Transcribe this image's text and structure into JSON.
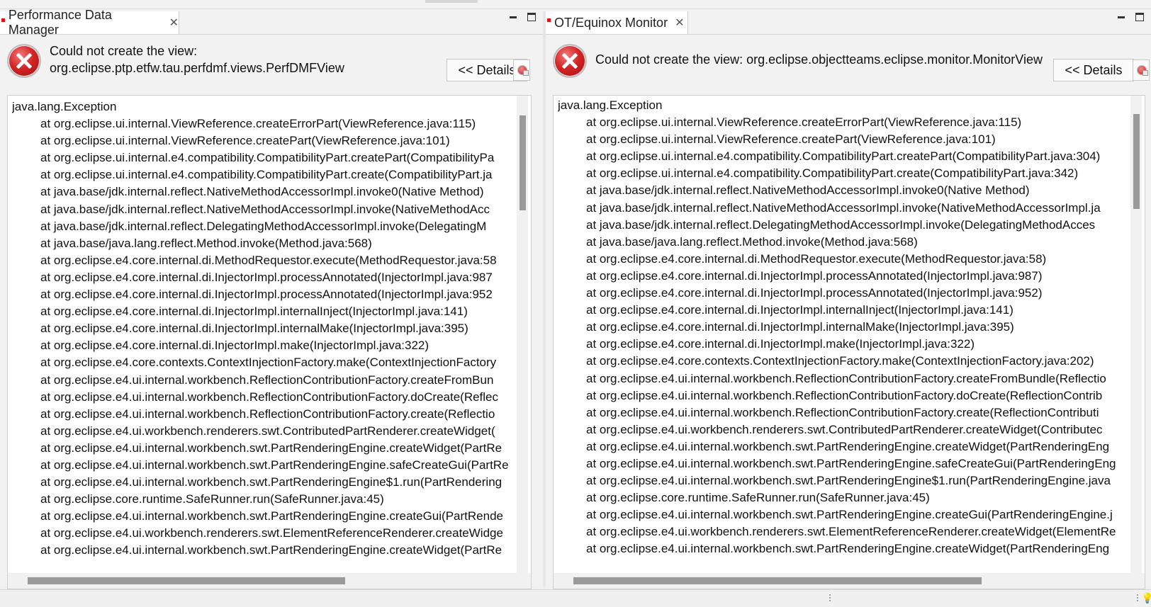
{
  "left_view": {
    "tab_title": "Performance Data Manager",
    "message_line1": "Could not create the view:",
    "message_line2": "org.eclipse.ptp.etfw.tau.perfdmf.views.PerfDMFView",
    "details_label": "<< Details",
    "trace": [
      "java.lang.Exception",
      "at org.eclipse.ui.internal.ViewReference.createErrorPart(ViewReference.java:115)",
      "at org.eclipse.ui.internal.ViewReference.createPart(ViewReference.java:101)",
      "at org.eclipse.ui.internal.e4.compatibility.CompatibilityPart.createPart(CompatibilityPa",
      "at org.eclipse.ui.internal.e4.compatibility.CompatibilityPart.create(CompatibilityPart.ja",
      "at java.base/jdk.internal.reflect.NativeMethodAccessorImpl.invoke0(Native Method)",
      "at java.base/jdk.internal.reflect.NativeMethodAccessorImpl.invoke(NativeMethodAcc",
      "at java.base/jdk.internal.reflect.DelegatingMethodAccessorImpl.invoke(DelegatingM",
      "at java.base/java.lang.reflect.Method.invoke(Method.java:568)",
      "at org.eclipse.e4.core.internal.di.MethodRequestor.execute(MethodRequestor.java:58",
      "at org.eclipse.e4.core.internal.di.InjectorImpl.processAnnotated(InjectorImpl.java:987",
      "at org.eclipse.e4.core.internal.di.InjectorImpl.processAnnotated(InjectorImpl.java:952",
      "at org.eclipse.e4.core.internal.di.InjectorImpl.internalInject(InjectorImpl.java:141)",
      "at org.eclipse.e4.core.internal.di.InjectorImpl.internalMake(InjectorImpl.java:395)",
      "at org.eclipse.e4.core.internal.di.InjectorImpl.make(InjectorImpl.java:322)",
      "at org.eclipse.e4.core.contexts.ContextInjectionFactory.make(ContextInjectionFactory",
      "at org.eclipse.e4.ui.internal.workbench.ReflectionContributionFactory.createFromBun",
      "at org.eclipse.e4.ui.internal.workbench.ReflectionContributionFactory.doCreate(Reflec",
      "at org.eclipse.e4.ui.internal.workbench.ReflectionContributionFactory.create(Reflectio",
      "at org.eclipse.e4.ui.workbench.renderers.swt.ContributedPartRenderer.createWidget(",
      "at org.eclipse.e4.ui.internal.workbench.swt.PartRenderingEngine.createWidget(PartRe",
      "at org.eclipse.e4.ui.internal.workbench.swt.PartRenderingEngine.safeCreateGui(PartRe",
      "at org.eclipse.e4.ui.internal.workbench.swt.PartRenderingEngine$1.run(PartRendering",
      "at org.eclipse.core.runtime.SafeRunner.run(SafeRunner.java:45)",
      "at org.eclipse.e4.ui.internal.workbench.swt.PartRenderingEngine.createGui(PartRende",
      "at org.eclipse.e4.ui.workbench.renderers.swt.ElementReferenceRenderer.createWidge",
      "at org.eclipse.e4.ui.internal.workbench.swt.PartRenderingEngine.createWidget(PartRe"
    ]
  },
  "right_view": {
    "tab_title": "OT/Equinox Monitor",
    "message": "Could not create the view: org.eclipse.objectteams.eclipse.monitor.MonitorView",
    "details_label": "<< Details",
    "trace": [
      "java.lang.Exception",
      "at org.eclipse.ui.internal.ViewReference.createErrorPart(ViewReference.java:115)",
      "at org.eclipse.ui.internal.ViewReference.createPart(ViewReference.java:101)",
      "at org.eclipse.ui.internal.e4.compatibility.CompatibilityPart.createPart(CompatibilityPart.java:304)",
      "at org.eclipse.ui.internal.e4.compatibility.CompatibilityPart.create(CompatibilityPart.java:342)",
      "at java.base/jdk.internal.reflect.NativeMethodAccessorImpl.invoke0(Native Method)",
      "at java.base/jdk.internal.reflect.NativeMethodAccessorImpl.invoke(NativeMethodAccessorImpl.ja",
      "at java.base/jdk.internal.reflect.DelegatingMethodAccessorImpl.invoke(DelegatingMethodAcces",
      "at java.base/java.lang.reflect.Method.invoke(Method.java:568)",
      "at org.eclipse.e4.core.internal.di.MethodRequestor.execute(MethodRequestor.java:58)",
      "at org.eclipse.e4.core.internal.di.InjectorImpl.processAnnotated(InjectorImpl.java:987)",
      "at org.eclipse.e4.core.internal.di.InjectorImpl.processAnnotated(InjectorImpl.java:952)",
      "at org.eclipse.e4.core.internal.di.InjectorImpl.internalInject(InjectorImpl.java:141)",
      "at org.eclipse.e4.core.internal.di.InjectorImpl.internalMake(InjectorImpl.java:395)",
      "at org.eclipse.e4.core.internal.di.InjectorImpl.make(InjectorImpl.java:322)",
      "at org.eclipse.e4.core.contexts.ContextInjectionFactory.make(ContextInjectionFactory.java:202)",
      "at org.eclipse.e4.ui.internal.workbench.ReflectionContributionFactory.createFromBundle(Reflectio",
      "at org.eclipse.e4.ui.internal.workbench.ReflectionContributionFactory.doCreate(ReflectionContrib",
      "at org.eclipse.e4.ui.internal.workbench.ReflectionContributionFactory.create(ReflectionContributi",
      "at org.eclipse.e4.ui.workbench.renderers.swt.ContributedPartRenderer.createWidget(Contributec",
      "at org.eclipse.e4.ui.internal.workbench.swt.PartRenderingEngine.createWidget(PartRenderingEng",
      "at org.eclipse.e4.ui.internal.workbench.swt.PartRenderingEngine.safeCreateGui(PartRenderingEng",
      "at org.eclipse.e4.ui.internal.workbench.swt.PartRenderingEngine$1.run(PartRenderingEngine.java",
      "at org.eclipse.core.runtime.SafeRunner.run(SafeRunner.java:45)",
      "at org.eclipse.e4.ui.internal.workbench.swt.PartRenderingEngine.createGui(PartRenderingEngine.j",
      "at org.eclipse.e4.ui.workbench.renderers.swt.ElementReferenceRenderer.createWidget(ElementRe",
      "at org.eclipse.e4.ui.internal.workbench.swt.PartRenderingEngine.createWidget(PartRenderingEng"
    ]
  },
  "icons": {
    "error": "error-icon",
    "tab_close": "close-icon",
    "minimize": "minimize-icon",
    "maximize": "maximize-icon",
    "report": "error-report-icon",
    "status_hint": "lightbulb-icon"
  },
  "glyphs": {
    "close": "✕",
    "bulb": "💡"
  },
  "colors": {
    "error_red": "#d42525",
    "tab_marker": "#dd1111"
  }
}
